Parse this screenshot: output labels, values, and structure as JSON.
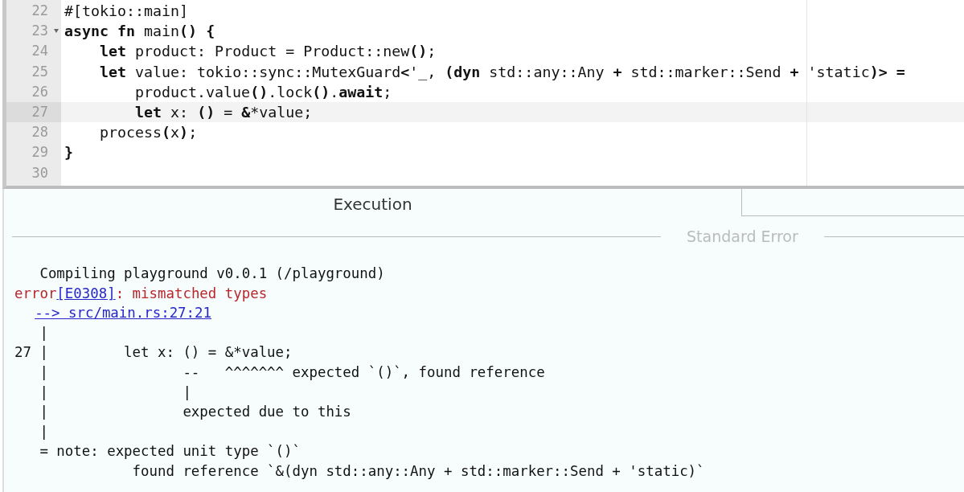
{
  "editor": {
    "lines": [
      {
        "number": "22",
        "code": "#[tokio::main]",
        "foldable": false,
        "selected": false
      },
      {
        "number": "23",
        "code": "**async fn** main**()** **{**",
        "foldable": true,
        "selected": false
      },
      {
        "number": "24",
        "code": "    **let** product: Product = Product::new**()**;",
        "foldable": false,
        "selected": false
      },
      {
        "number": "25",
        "code": "    **let** value: tokio::sync::MutexGuard**<**'_, **(dyn** std::any::Any **+** std::marker::Send **+** 'static**)> =**",
        "foldable": false,
        "selected": false
      },
      {
        "number": "26",
        "code": "        product.value**()**.lock**()**.**await**;",
        "foldable": false,
        "selected": false
      },
      {
        "number": "27",
        "code": "        **let** x: **()** = **&***value;",
        "foldable": false,
        "selected": true
      },
      {
        "number": "28",
        "code": "    process**(**x**)**;",
        "foldable": false,
        "selected": false
      },
      {
        "number": "29",
        "code": "**}**",
        "foldable": false,
        "selected": false
      },
      {
        "number": "30",
        "foldable": false,
        "selected": false
      }
    ]
  },
  "output": {
    "tabs": [
      {
        "label": "Execution",
        "selected": true
      }
    ],
    "section_label": "Standard Error",
    "lines": [
      {
        "segments": [
          {
            "kind": "plain",
            "text": "   Compiling playground v0.0.1 (/playground)"
          }
        ]
      },
      {
        "segments": [
          {
            "kind": "error",
            "text": "error"
          },
          {
            "kind": "link",
            "text": "[E0308]"
          },
          {
            "kind": "error",
            "text": ": mismatched types"
          }
        ]
      },
      {
        "segments": [
          {
            "kind": "link",
            "text": "--> src/main.rs:27:21"
          }
        ]
      },
      {
        "segments": [
          {
            "kind": "plain",
            "text": "   |"
          }
        ]
      },
      {
        "segments": [
          {
            "kind": "plain",
            "text": "27 |         let x: () = &*value;"
          }
        ]
      },
      {
        "segments": [
          {
            "kind": "plain",
            "text": "   |                --   ^^^^^^^ expected `()`, found reference"
          }
        ]
      },
      {
        "segments": [
          {
            "kind": "plain",
            "text": "   |                |"
          }
        ]
      },
      {
        "segments": [
          {
            "kind": "plain",
            "text": "   |                expected due to this"
          }
        ]
      },
      {
        "segments": [
          {
            "kind": "plain",
            "text": "   |"
          }
        ]
      },
      {
        "segments": [
          {
            "kind": "plain",
            "text": "   = note: expected unit type `()`"
          }
        ]
      },
      {
        "segments": [
          {
            "kind": "plain",
            "text": "              found reference `&(dyn std::any::Any + std::marker::Send + 'static)`"
          }
        ]
      }
    ]
  }
}
